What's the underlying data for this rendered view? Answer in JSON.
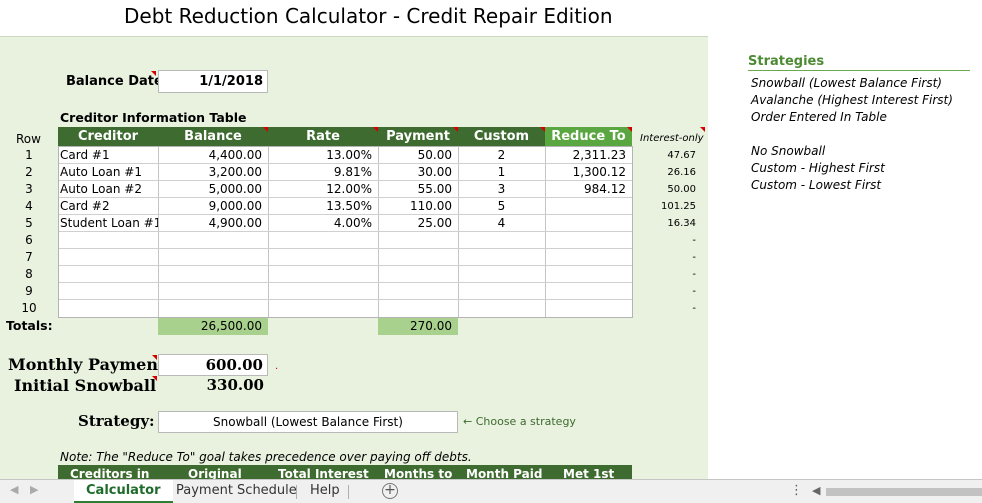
{
  "title": "Debt Reduction Calculator - Credit Repair Edition",
  "balance_date": {
    "label": "Balance Date:",
    "value": "1/1/2018"
  },
  "table_title": "Creditor Information Table",
  "row_header": "Row",
  "columns": [
    "Creditor",
    "Balance",
    "Rate",
    "Payment",
    "Custom",
    "Reduce To"
  ],
  "interest_only_header": "Interest-only",
  "rows": [
    {
      "num": "1",
      "creditor": "Card #1",
      "balance": "4,400.00",
      "rate": "13.00%",
      "payment": "50.00",
      "custom": "2",
      "reduce": "2,311.23",
      "io": "47.67"
    },
    {
      "num": "2",
      "creditor": "Auto Loan #1",
      "balance": "3,200.00",
      "rate": "9.81%",
      "payment": "30.00",
      "custom": "1",
      "reduce": "1,300.12",
      "io": "26.16"
    },
    {
      "num": "3",
      "creditor": "Auto Loan #2",
      "balance": "5,000.00",
      "rate": "12.00%",
      "payment": "55.00",
      "custom": "3",
      "reduce": "984.12",
      "io": "50.00"
    },
    {
      "num": "4",
      "creditor": "Card #2",
      "balance": "9,000.00",
      "rate": "13.50%",
      "payment": "110.00",
      "custom": "5",
      "reduce": "",
      "io": "101.25"
    },
    {
      "num": "5",
      "creditor": "Student Loan #1",
      "balance": "4,900.00",
      "rate": "4.00%",
      "payment": "25.00",
      "custom": "4",
      "reduce": "",
      "io": "16.34"
    },
    {
      "num": "6",
      "creditor": "",
      "balance": "",
      "rate": "",
      "payment": "",
      "custom": "",
      "reduce": "",
      "io": "-"
    },
    {
      "num": "7",
      "creditor": "",
      "balance": "",
      "rate": "",
      "payment": "",
      "custom": "",
      "reduce": "",
      "io": "-"
    },
    {
      "num": "8",
      "creditor": "",
      "balance": "",
      "rate": "",
      "payment": "",
      "custom": "",
      "reduce": "",
      "io": "-"
    },
    {
      "num": "9",
      "creditor": "",
      "balance": "",
      "rate": "",
      "payment": "",
      "custom": "",
      "reduce": "",
      "io": "-"
    },
    {
      "num": "10",
      "creditor": "",
      "balance": "",
      "rate": "",
      "payment": "",
      "custom": "",
      "reduce": "",
      "io": "-"
    }
  ],
  "totals": {
    "label": "Totals:",
    "balance": "26,500.00",
    "payment": "270.00"
  },
  "monthly_payment": {
    "label": "Monthly Payment",
    "value": "600.00"
  },
  "initial_snowball": {
    "label": "Initial Snowball",
    "value": "330.00"
  },
  "strategy": {
    "label": "Strategy:",
    "value": "Snowball (Lowest Balance First)",
    "hint": "← Choose a strategy"
  },
  "note": "Note: The \"Reduce To\" goal takes precedence over paying off debts.",
  "bottom_headers": [
    "Creditors in",
    "Original",
    "Total Interest",
    "Months to",
    "Month Paid",
    "Met 1st"
  ],
  "strategies": {
    "title": "Strategies",
    "items": [
      "Snowball (Lowest Balance First)",
      "Avalanche (Highest Interest First)",
      "Order Entered In Table",
      "",
      "No Snowball",
      "Custom - Highest First",
      "Custom - Lowest First"
    ]
  },
  "tabs": [
    "Calculator",
    "Payment Schedule",
    "Help"
  ],
  "colors": {
    "header_green": "#3e6b2f",
    "reduce_green": "#5aa640",
    "sheet_bg": "#e8f2df",
    "total_green": "#a9d18e"
  }
}
